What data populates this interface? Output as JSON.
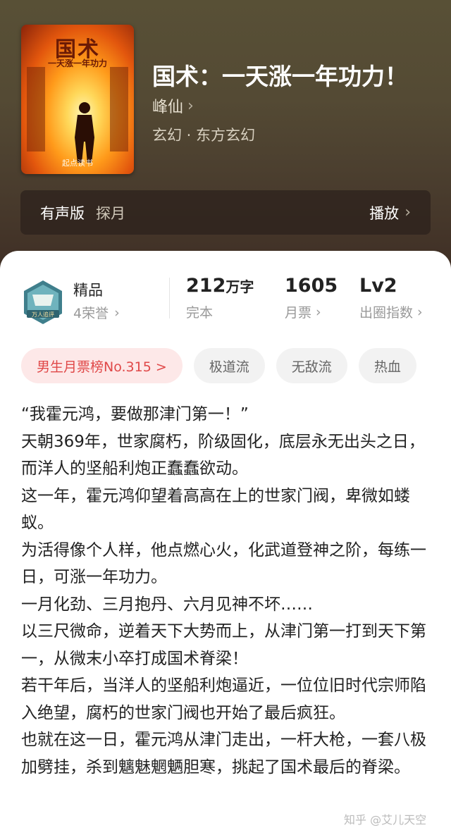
{
  "book": {
    "title": "国术：一天涨一年功力！",
    "author": "峰仙",
    "genre": "玄幻 · 东方玄幻",
    "cover": {
      "title": "国术",
      "subtitle": "一天涨一年功力",
      "brand": "起点读书"
    }
  },
  "audio": {
    "label": "有声版",
    "narrator": "探月",
    "play_label": "播放"
  },
  "badge": {
    "quality": "精品",
    "honors": "4荣誉",
    "emblem_text": "万人追评"
  },
  "stats": [
    {
      "value": "212",
      "unit": "万字",
      "label": "完本"
    },
    {
      "value": "1605",
      "label": "月票"
    },
    {
      "value": "Lv2",
      "label": "出圈指数"
    }
  ],
  "tags": [
    {
      "label": "男生月票榜No.315 >"
    },
    {
      "label": "极道流"
    },
    {
      "label": "无敌流"
    },
    {
      "label": "热血"
    }
  ],
  "synopsis": [
    "“我霍元鸿，要做那津门第一！”",
    "天朝369年，世家腐朽，阶级固化，底层永无出头之日，而洋人的坚船利炮正蠢蠢欲动。",
    "这一年，霍元鸿仰望着高高在上的世家门阀，卑微如蝼蚁。",
    "为活得像个人样，他点燃心火，化武道登神之阶，每练一日，可涨一年功力。",
    "一月化劲、三月抱丹、六月见神不坏……",
    "以三尺微命，逆着天下大势而上，从津门第一打到天下第一，从微末小卒打成国术脊梁！",
    "若干年后，当洋人的坚船利炮逼近，一位位旧时代宗师陷入绝望，腐朽的世家门阀也开始了最后疯狂。",
    "也就在这一日，霍元鸿从津门走出，一杆大枪，一套八极加劈挂，杀到魑魅魍魉胆寒，挑起了国术最后的脊梁。"
  ],
  "watermark": "知乎 @艾儿天空",
  "colors": {
    "hero_bg": "#544a34",
    "rank_tag_text": "#e04848",
    "rank_tag_bg": "#fde8e8"
  }
}
